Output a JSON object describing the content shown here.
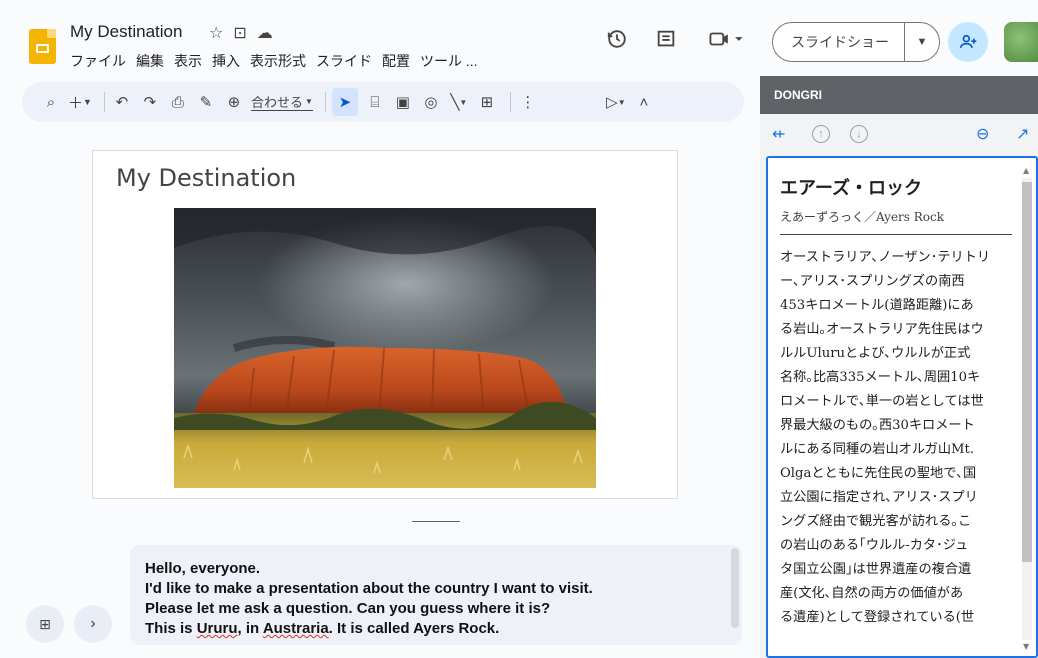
{
  "app": {
    "doc_title": "My Destination",
    "menus": [
      "ファイル",
      "編集",
      "表示",
      "挿入",
      "表示形式",
      "スライド",
      "配置",
      "ツール ..."
    ]
  },
  "header": {
    "slideshow_label": "スライドショー"
  },
  "toolbar": {
    "zoom_label": "合わせる"
  },
  "slide": {
    "title": "My Destination"
  },
  "notes": {
    "lines": [
      "Hello, everyone.",
      "I'd like to make a presentation about the country I want to visit.",
      "Please let me ask a question. Can you guess where it is?",
      "This is Ururu, in Austraria. It is called Ayers Rock."
    ]
  },
  "side_panel": {
    "header": "DONGRI",
    "word": "エアーズ・ロック",
    "reading": "えあーずろっく／Ayers Rock",
    "body_lines": [
      "オーストラリア､ノーザン･テリトリ",
      "ー､アリス･スプリングズの南西",
      "453キロメートル(道路距離)にあ",
      "る岩山｡オーストラリア先住民はウ",
      "ルルUluruとよび､ウルルが正式",
      "名称｡比高335メートル､周囲10キ",
      "ロメートルで､単一の岩としては世",
      "界最大級のもの｡西30キロメート",
      "ルにある同種の岩山オルガ山Mt.",
      "Olgaとともに先住民の聖地で､国",
      "立公園に指定され､アリス･スプリ",
      "ングズ経由で観光客が訪れる｡こ",
      "の岩山のある｢ウルル-カタ･ジュ",
      "タ国立公園｣は世界遺産の複合遺",
      "産(文化､自然の両方の価値があ",
      "る遺産)として登録されている(世"
    ]
  },
  "colors": {
    "accent": "#1a73e8",
    "slides_yellow": "#f4b400",
    "toolbar_bg": "#edf2fa",
    "panel_header": "#5f6368"
  }
}
